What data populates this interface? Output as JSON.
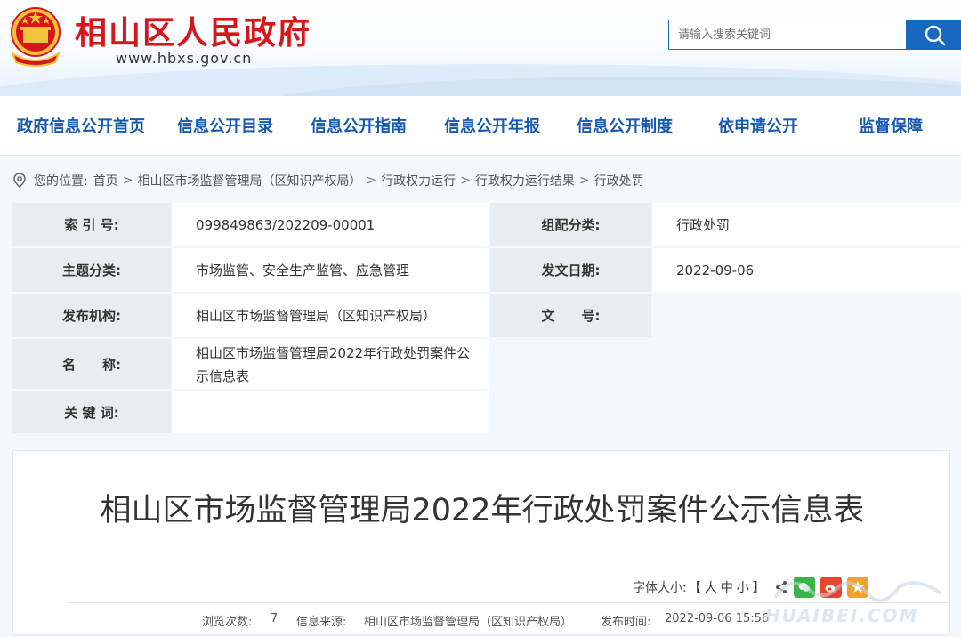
{
  "header": {
    "site_title": "相山区人民政府",
    "site_url": "www.hbxs.gov.cn",
    "search_placeholder": "请输入搜索关键词"
  },
  "nav": {
    "items": [
      {
        "label": "政府信息公开首页"
      },
      {
        "label": "信息公开目录"
      },
      {
        "label": "信息公开指南"
      },
      {
        "label": "信息公开年报"
      },
      {
        "label": "信息公开制度"
      },
      {
        "label": "依申请公开"
      },
      {
        "label": "监督保障"
      }
    ]
  },
  "breadcrumb": {
    "prefix": "您的位置:",
    "items": [
      "首页",
      "相山区市场监督管理局（区知识产权局）",
      "行政权力运行",
      "行政权力运行结果",
      "行政处罚"
    ],
    "separator": ">"
  },
  "info": {
    "index_label": "索 引 号:",
    "index_value": "099849863/202209-00001",
    "category_label": "组配分类:",
    "category_value": "行政处罚",
    "topic_label": "主题分类:",
    "topic_value": "市场监管、安全生产监管、应急管理",
    "date_label": "发文日期:",
    "date_value": "2022-09-06",
    "org_label": "发布机构:",
    "org_value": "相山区市场监督管理局（区知识产权局）",
    "docno_label": "文　　号:",
    "docno_value": "",
    "name_label": "名　　称:",
    "name_value_line1": "相山区市场监督管理局2022年行政处罚案件公",
    "name_value_line2": "示信息表",
    "keywords_label": "关 键 词:",
    "keywords_value": ""
  },
  "article": {
    "title": "相山区市场监督管理局2022年行政处罚案件公示信息表",
    "font_size_label": "字体大小:",
    "font_sizes": [
      "大",
      "中",
      "小"
    ],
    "views_label": "浏览次数:",
    "views_value": "7",
    "source_label": "信息来源:",
    "source_value": "相山区市场监督管理局（区知识产权局）",
    "publish_label": "发布时间:",
    "publish_value": "2022-09-06 15:56"
  },
  "watermark": {
    "text": "HUAIBEI.COM"
  },
  "colors": {
    "brand_red": "#d7161b",
    "nav_blue": "#1659b0",
    "search_blue": "#1668c1",
    "label_bg": "#e9edf2"
  }
}
